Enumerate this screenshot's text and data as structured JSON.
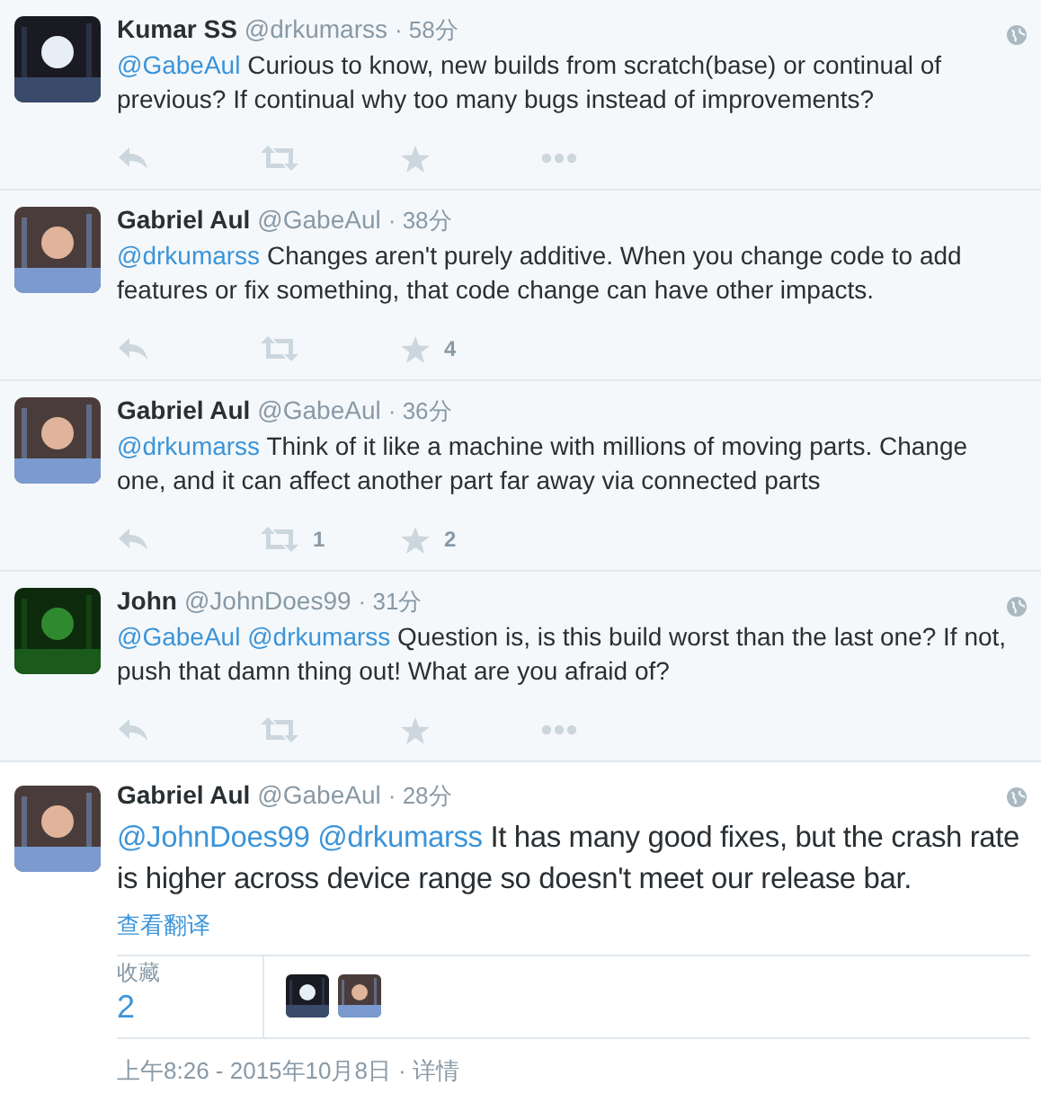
{
  "tweets": [
    {
      "kind": "reply",
      "name": "Kumar SS",
      "handle": "@drkumarss",
      "time": "· 58分",
      "mentions": [
        "@GabeAul"
      ],
      "text": "Curious to know, new builds from scratch(base) or continual of previous? If continual why too many bugs instead of improvements?",
      "hovered": true
    },
    {
      "kind": "reply",
      "name": "Gabriel Aul",
      "handle": "@GabeAul",
      "time": "· 38分",
      "mentions": [
        "@drkumarss"
      ],
      "text": "Changes aren't purely additive. When you change code to add features or fix something, that code change can have other impacts.",
      "hovered": false,
      "favorites": "4"
    },
    {
      "kind": "reply",
      "name": "Gabriel Aul",
      "handle": "@GabeAul",
      "time": "· 36分",
      "mentions": [
        "@drkumarss"
      ],
      "text": "Think of it like a machine with millions of moving parts. Change one, and it can affect another part far away via connected parts",
      "hovered": false,
      "retweets": "1",
      "favorites": "2"
    },
    {
      "kind": "reply",
      "name": "John",
      "handle": "@JohnDoes99",
      "time": "· 31分",
      "mentions": [
        "@GabeAul",
        "@drkumarss"
      ],
      "text": "Question is, is this build worst than the last one? If not, push that damn thing out! What are you afraid of?",
      "hovered": true
    },
    {
      "kind": "focused",
      "name": "Gabriel Aul",
      "handle": "@GabeAul",
      "time": "· 28分",
      "mentions": [
        "@JohnDoes99",
        "@drkumarss"
      ],
      "text": "It has many good fixes, but the crash rate is higher across device range so doesn't meet our release bar.",
      "hovered": true,
      "translate": "查看翻译",
      "stats_label": "收藏",
      "stats_count": "2",
      "timestamp": "上午8:26 - 2015年10月8日",
      "details": "· 详情"
    }
  ]
}
